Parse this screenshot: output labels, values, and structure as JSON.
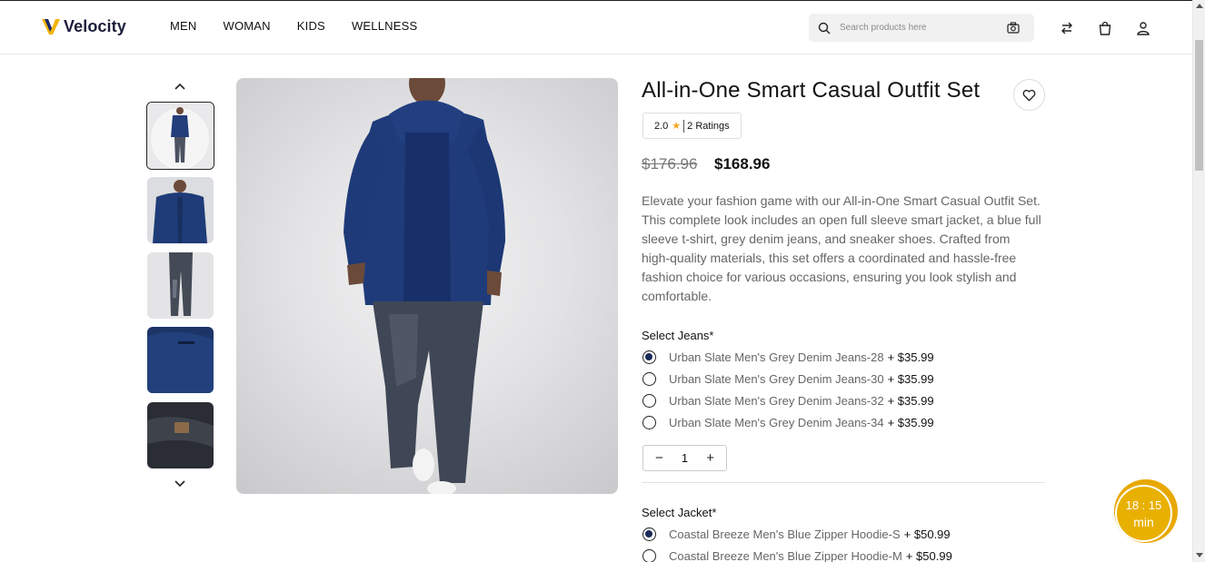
{
  "brand": {
    "name": "Velocity"
  },
  "nav": [
    "MEN",
    "WOMAN",
    "KIDS",
    "WELLNESS"
  ],
  "search": {
    "placeholder": "Search products here"
  },
  "product": {
    "title": "All-in-One Smart Casual Outfit Set",
    "rating": "2.0",
    "ratings_count": "2 Ratings",
    "old_price": "$176.96",
    "new_price": "$168.96",
    "description": "Elevate your fashion game with our All-in-One Smart Casual Outfit Set. This complete look includes an open full sleeve smart jacket, a blue full sleeve t-shirt, grey denim jeans, and sneaker shoes. Crafted from high-quality materials, this set offers a coordinated and hassle-free fashion choice for various occasions, ensuring you look stylish and comfortable."
  },
  "jeans": {
    "label": "Select Jeans*",
    "options": [
      {
        "name": "Urban Slate Men's Grey Denim Jeans-28",
        "price": "+ $35.99",
        "checked": true
      },
      {
        "name": "Urban Slate Men's Grey Denim Jeans-30",
        "price": "+ $35.99",
        "checked": false
      },
      {
        "name": "Urban Slate Men's Grey Denim Jeans-32",
        "price": "+ $35.99",
        "checked": false
      },
      {
        "name": "Urban Slate Men's Grey Denim Jeans-34",
        "price": "+ $35.99",
        "checked": false
      }
    ],
    "quantity": "1"
  },
  "jacket": {
    "label": "Select Jacket*",
    "options": [
      {
        "name": "Coastal Breeze Men's Blue Zipper Hoodie-S",
        "price": "+ $50.99",
        "checked": true
      },
      {
        "name": "Coastal Breeze Men's Blue Zipper Hoodie-M",
        "price": "+ $50.99",
        "checked": false
      }
    ]
  },
  "timer": {
    "time": "18 : 15",
    "unit": "min"
  },
  "colors": {
    "brand_navy": "#1b1f3b",
    "timer_gold": "#e8b000",
    "star": "#f5a623"
  }
}
